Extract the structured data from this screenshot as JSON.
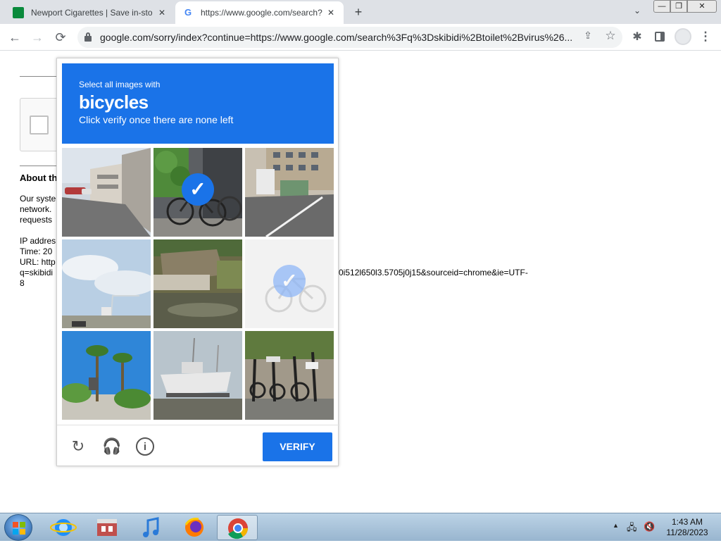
{
  "browser": {
    "tabs": [
      {
        "title": "Newport Cigarettes | Save in-sto",
        "close": "✕",
        "favicon": "newport-favicon"
      },
      {
        "title": "https://www.google.com/search?",
        "close": "✕",
        "favicon": "google-favicon",
        "favicon_glyph": "G"
      }
    ],
    "new_tab": "+",
    "tab_dropdown": "⌄",
    "window_controls": {
      "minimize": "—",
      "maximize": "❐",
      "close": "✕"
    },
    "nav": {
      "back": "←",
      "forward": "→",
      "reload": "⟳"
    },
    "url": "google.com/sorry/index?continue=https://www.google.com/search%3Fq%3Dskibidi%2Btoilet%2Bvirus%26...",
    "share": "⇪",
    "star": "☆",
    "extensions": "✱",
    "menu": "⋮"
  },
  "page": {
    "about_heading": "About th",
    "para_lines": [
      "Our syste",
      "network.",
      "requests"
    ],
    "ip_lines": [
      "IP addres",
      "Time: 20",
      "URL: http",
      "q=skibidi"
    ],
    "url_tail": "0i512l650l3.5705j0j15&sourceid=chrome&ie=UTF-",
    "url_tail_end": "8"
  },
  "captcha": {
    "select_text": "Select all images with",
    "target_word": "bicycles",
    "subtitle": "Click verify once there are none left",
    "check_glyph": "✓",
    "tiles": [
      {
        "scene": "parking lot with building",
        "selected": false
      },
      {
        "scene": "bicycles in front of wall",
        "selected": true
      },
      {
        "scene": "street with apartment building",
        "selected": false
      },
      {
        "scene": "sky with crane",
        "selected": false
      },
      {
        "scene": "flooded yard with shed",
        "selected": false
      },
      {
        "scene": "faded bicycle (loading)",
        "selected": true
      },
      {
        "scene": "palm trees",
        "selected": false
      },
      {
        "scene": "boat on trailer",
        "selected": false
      },
      {
        "scene": "rental bicycles",
        "selected": false
      }
    ],
    "footer": {
      "reload_icon": "↻",
      "audio_icon": "🎧",
      "info_icon": "i",
      "verify_label": "VERIFY"
    }
  },
  "taskbar": {
    "apps": [
      "Internet Explorer",
      "Store",
      "iTunes",
      "Firefox",
      "Chrome"
    ],
    "tray": {
      "up": "▲",
      "network": "🖧",
      "volume": "🔇"
    },
    "time": "1:43 AM",
    "date": "11/28/2023"
  },
  "colors": {
    "accent": "#1a73e8",
    "tab_bar": "#dee1e6",
    "taskbar": "#a8c2d9"
  }
}
